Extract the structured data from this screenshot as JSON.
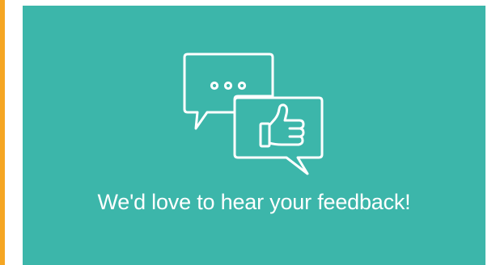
{
  "colors": {
    "accent": "#f5a623",
    "card_background": "#3cb6aa",
    "foreground": "#ffffff"
  },
  "illustration": {
    "icons": [
      "speech-bubble-ellipsis-icon",
      "thumbs-up-bubble-icon"
    ]
  },
  "card": {
    "headline": "We'd love to hear your feedback!"
  }
}
